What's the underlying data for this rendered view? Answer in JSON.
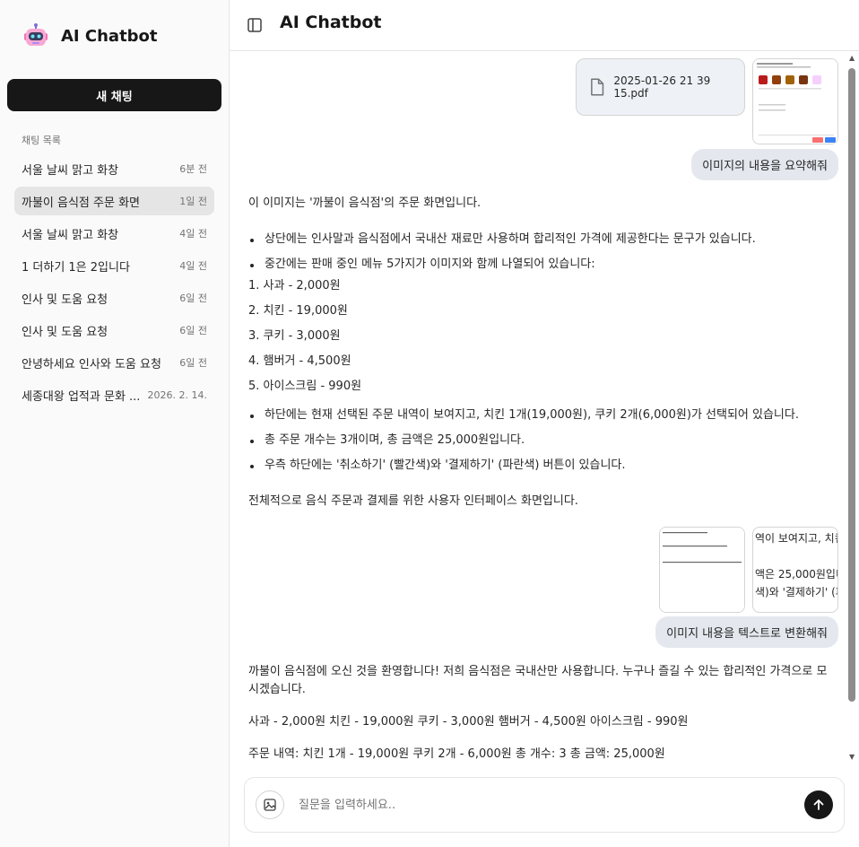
{
  "app": {
    "title": "AI Chatbot",
    "logo_icon": "robot-icon",
    "accent": "#171717"
  },
  "sidebar": {
    "new_chat_label": "새 채팅",
    "list_heading": "채팅 목록",
    "items": [
      {
        "title": "서울 날씨 맑고 화창",
        "time": "6분 전",
        "active": false
      },
      {
        "title": "까불이 음식점 주문 화면",
        "time": "1일 전",
        "active": true
      },
      {
        "title": "서울 날씨 맑고 화창",
        "time": "4일 전",
        "active": false
      },
      {
        "title": "1 더하기 1은 2입니다",
        "time": "4일 전",
        "active": false
      },
      {
        "title": "인사 및 도움 요청",
        "time": "6일 전",
        "active": false
      },
      {
        "title": "인사 및 도움 요청",
        "time": "6일 전",
        "active": false
      },
      {
        "title": "안녕하세요 인사와 도움 요청",
        "time": "6일 전",
        "active": false
      },
      {
        "title": "세종대왕 업적과 문화 ...",
        "time": "2026. 2. 14.",
        "active": false
      }
    ]
  },
  "header": {
    "title": "AI Chatbot",
    "toggle_icon": "sidebar-toggle-icon"
  },
  "messages": {
    "attachment": {
      "file_name": "2025-01-26 21 39 15.pdf",
      "icon": "file-icon"
    },
    "user_1": "이미지의 내용을 요약해줘",
    "assistant_1": {
      "intro": "이 이미지는 '까불이 음식점'의 주문 화면입니다.",
      "bullet_1": "상단에는 인사말과 음식점에서 국내산 재료만 사용하며 합리적인 가격에 제공한다는 문구가 있습니다.",
      "bullet_2": "중간에는 판매 중인 메뉴 5가지가 이미지와 함께 나열되어 있습니다:",
      "menu": [
        "1. 사과 - 2,000원",
        "2. 치킨 - 19,000원",
        "3. 쿠키 - 3,000원",
        "4. 햄버거 - 4,500원",
        "5. 아이스크림 - 990원"
      ],
      "bullet_3": "하단에는 현재 선택된 주문 내역이 보여지고, 치킨 1개(19,000원), 쿠키 2개(6,000원)가 선택되어 있습니다.",
      "bullet_4": "총 주문 개수는 3개이며, 총 금액은 25,000원입니다.",
      "bullet_5": "우측 하단에는 '취소하기' (빨간색)와 '결제하기' (파란색) 버튼이 있습니다.",
      "outro": "전체적으로 음식 주문과 결제를 위한 사용자 인터페이스 화면입니다."
    },
    "thumb_3_lines": [
      "역이 보여지고, 치킨",
      "액은 25,000원입니",
      "색)와 '결제하기' (파"
    ],
    "user_2": "이미지 내용을 텍스트로 변환해줘",
    "assistant_2": {
      "p1": "까불이 음식점에 오신 것을 환영합니다! 저희 음식점은 국내산만 사용합니다. 누구나 즐길 수 있는 합리적인 가격으로 모시겠습니다.",
      "p2": "사과 - 2,000원 치킨 - 19,000원 쿠키 - 3,000원 햄버거 - 4,500원 아이스크림 - 990원",
      "p3": "주문 내역: 치킨 1개 - 19,000원 쿠키 2개 - 6,000원 총 개수: 3 총 금액: 25,000원"
    }
  },
  "composer": {
    "placeholder": "질문을 입력하세요..",
    "attach_icon": "image-icon",
    "send_icon": "arrow-up-icon"
  }
}
